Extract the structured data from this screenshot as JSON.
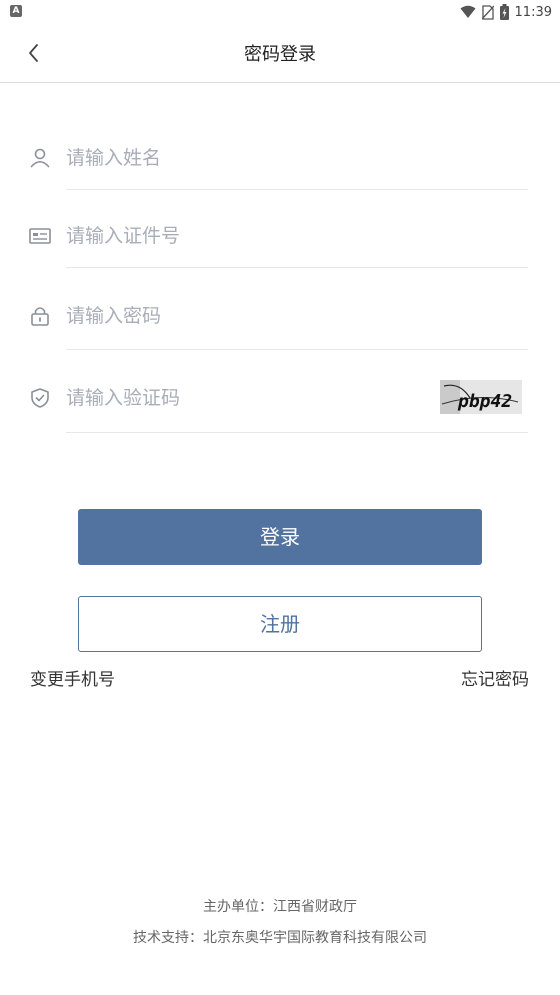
{
  "status_bar": {
    "time": "11:39",
    "left_badge": "A",
    "icons": [
      "wifi-icon",
      "no-sim-icon",
      "battery-charging-icon"
    ]
  },
  "header": {
    "title": "密码登录",
    "back_icon": "chevron-left-icon"
  },
  "form": {
    "name": {
      "placeholder": "请输入姓名",
      "value": "",
      "icon": "user-icon"
    },
    "id_number": {
      "placeholder": "请输入证件号",
      "value": "",
      "icon": "id-card-icon"
    },
    "password": {
      "placeholder": "请输入密码",
      "value": "",
      "icon": "lock-icon"
    },
    "captcha": {
      "placeholder": "请输入验证码",
      "value": "",
      "icon": "shield-check-icon",
      "image_text": "pbp42"
    }
  },
  "buttons": {
    "login": "登录",
    "register": "注册"
  },
  "links": {
    "change_phone": "变更手机号",
    "forgot_password": "忘记密码"
  },
  "footer": {
    "sponsor": "主办单位：江西省财政厅",
    "support": "技术支持：北京东奥华宇国际教育科技有限公司"
  },
  "colors": {
    "primary": "#52729f",
    "placeholder": "#a8adb8",
    "divider": "#e8e8e8"
  }
}
